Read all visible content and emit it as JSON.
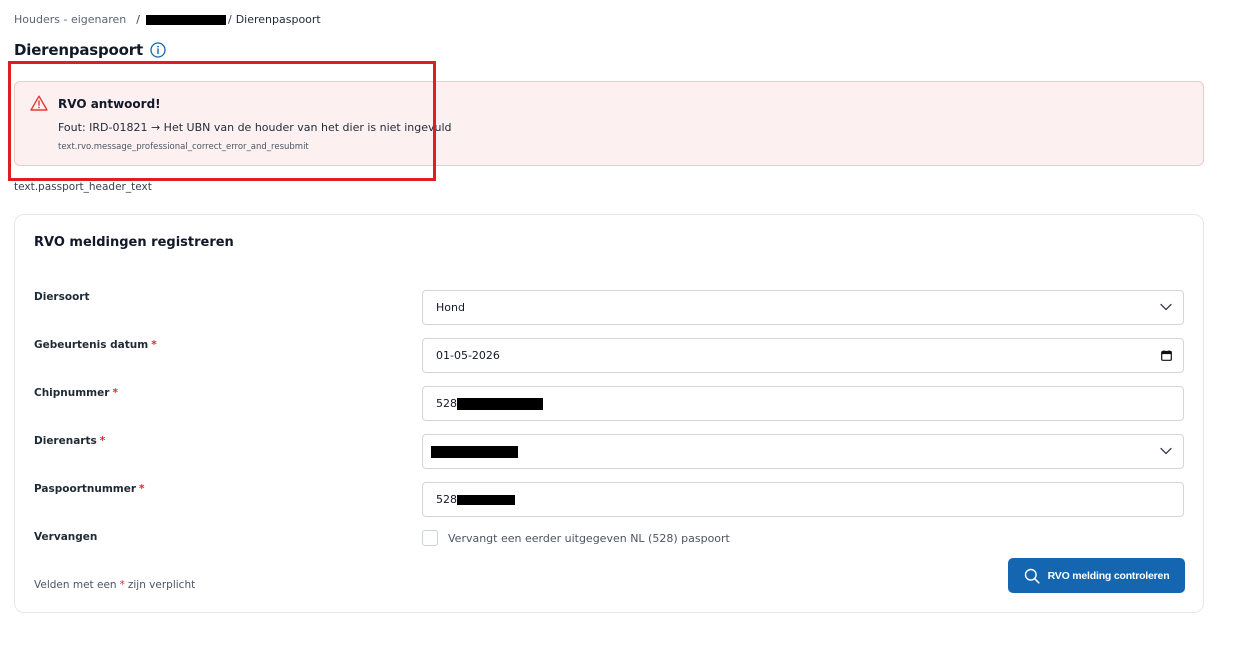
{
  "breadcrumb": {
    "items": [
      "Houders - eigenaren",
      "Dierenpaspoort"
    ],
    "separator": "/"
  },
  "page": {
    "title": "Dierenpaspoort",
    "header_text": "text.passport_header_text"
  },
  "alert": {
    "title": "RVO antwoord!",
    "message": "Fout: IRD-01821 → Het UBN van de houder van het dier is niet ingevuld",
    "note": "text.rvo.message_professional_correct_error_and_resubmit",
    "icon": "warning-triangle-icon",
    "color": "#e53935"
  },
  "form": {
    "title": "RVO meldingen registreren",
    "fields": {
      "diersoort": {
        "label": "Diersoort",
        "value": "Hond"
      },
      "datum": {
        "label": "Gebeurtenis datum",
        "required_mark": "*",
        "value": "01-05-2026"
      },
      "chip": {
        "label": "Chipnummer",
        "required_mark": "*",
        "value_prefix": "528"
      },
      "dierenarts": {
        "label": "Dierenarts",
        "required_mark": "*"
      },
      "paspoort": {
        "label": "Paspoortnummer",
        "required_mark": "*",
        "value_prefix": "528"
      },
      "vervangen": {
        "label": "Vervangen",
        "checkbox_label": "Vervangt een eerder uitgegeven NL (528) paspoort",
        "checked": false
      }
    },
    "required_note": {
      "before": "Velden met een",
      "mark": "*",
      "after": "zijn verplicht"
    },
    "submit_label": "RVO melding controleren"
  },
  "colors": {
    "primary": "#1566b0",
    "alert_bg": "#fdf0f1",
    "required": "#d32f2f",
    "highlight": "#e11d24"
  }
}
